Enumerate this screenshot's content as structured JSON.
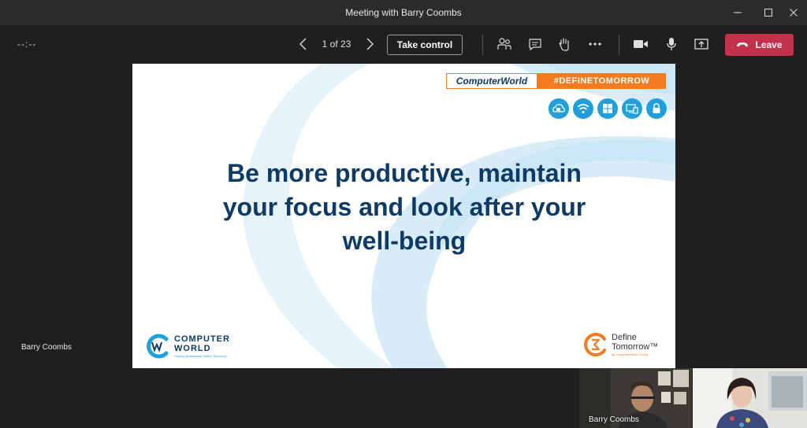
{
  "window": {
    "title": "Meeting with Barry Coombs"
  },
  "toolbar": {
    "timer": "--:--",
    "page_count": "1 of 23",
    "take_control_label": "Take control",
    "leave_label": "Leave",
    "icons": [
      "chevron-left-icon",
      "chevron-right-icon",
      "participants-icon",
      "chat-icon",
      "raise-hand-icon",
      "more-icon",
      "camera-icon",
      "microphone-icon",
      "share-tray-icon",
      "phone-hangup-icon"
    ]
  },
  "slide": {
    "banner_left": "ComputerWorld",
    "banner_right": "#DEFINETOMORROW",
    "title_lines": [
      "Be more productive, maintain",
      "your focus and look after your",
      "well-being"
    ],
    "logo_left_line1": "COMPUTER",
    "logo_left_line2": "WORLD",
    "logo_left_tagline": "Helping Businesses Define Tomorrow",
    "logo_right_line1": "Define",
    "logo_right_line2": "Tomorrow™",
    "logo_right_tagline": "By ComputerWorld Group",
    "icons": [
      "cloud-outlook-icon",
      "wifi-icon",
      "windows-icon",
      "devices-icon",
      "lock-icon"
    ]
  },
  "presenter_name": "Barry Coombs",
  "video_tiles": [
    {
      "name": "Barry Coombs"
    },
    {
      "name": ""
    }
  ],
  "colors": {
    "leave": "#c4314b",
    "brand_navy": "#0e3a66",
    "brand_orange": "#f47b20",
    "brand_blue": "#1fa0dc"
  }
}
